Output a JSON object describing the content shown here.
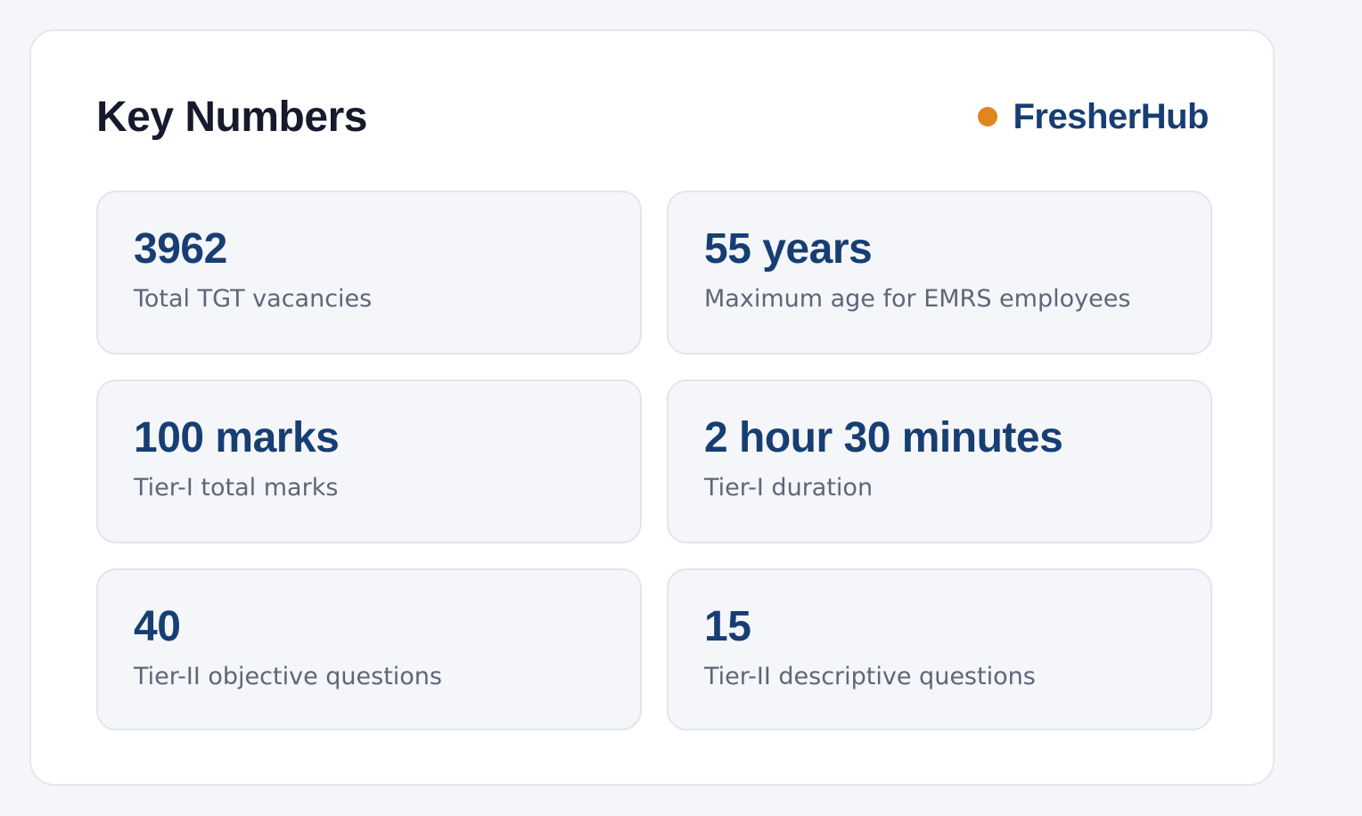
{
  "header": {
    "title": "Key Numbers",
    "brand": "FresherHub"
  },
  "colors": {
    "accent": "#173e73",
    "brand_dot": "#e0861d",
    "text_muted": "#5e6678"
  },
  "stats": [
    {
      "value": "3962",
      "label": "Total TGT vacancies"
    },
    {
      "value": "55 years",
      "label": "Maximum age for EMRS employees"
    },
    {
      "value": "100 marks",
      "label": "Tier-I total marks"
    },
    {
      "value": "2 hour 30 minutes",
      "label": "Tier-I duration"
    },
    {
      "value": "40",
      "label": "Tier-II objective questions"
    },
    {
      "value": "15",
      "label": "Tier-II descriptive questions"
    }
  ]
}
